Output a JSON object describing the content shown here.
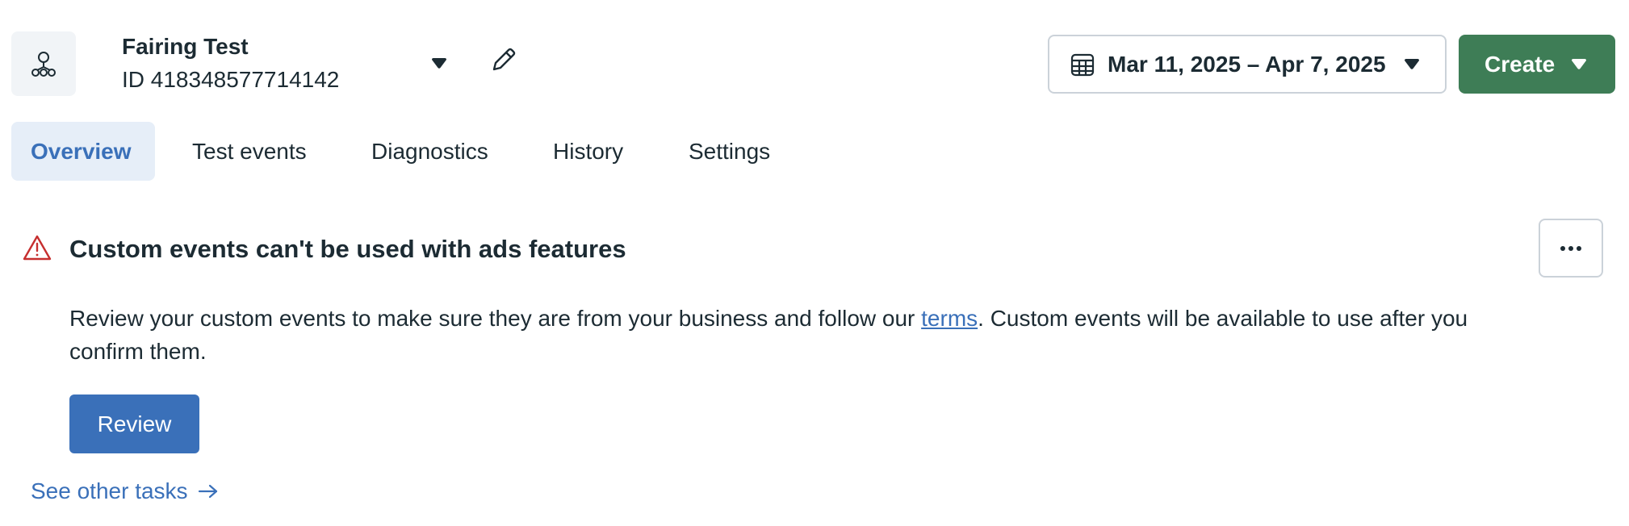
{
  "header": {
    "dataset_name": "Fairing Test",
    "dataset_id": "ID 418348577714142",
    "dataset_icon": "network-icon",
    "date_range": "Mar 11, 2025 – Apr 7, 2025",
    "create_label": "Create"
  },
  "tabs": [
    {
      "label": "Overview",
      "active": true
    },
    {
      "label": "Test events",
      "active": false
    },
    {
      "label": "Diagnostics",
      "active": false
    },
    {
      "label": "History",
      "active": false
    },
    {
      "label": "Settings",
      "active": false
    }
  ],
  "alert": {
    "title": "Custom events can't be used with ads features",
    "body_before_link": "Review your custom events to make sure they are from your business and follow our ",
    "link_text": "terms",
    "body_after_link": ". Custom events will be available to use after you confirm them.",
    "review_label": "Review",
    "severity_color": "#c62f2f"
  },
  "footer": {
    "see_other_tasks": "See other tasks"
  },
  "colors": {
    "accent_blue": "#3a70b9",
    "create_green": "#3e7d56",
    "active_tab_bg": "#e6eef8",
    "text": "#1c2b33"
  }
}
